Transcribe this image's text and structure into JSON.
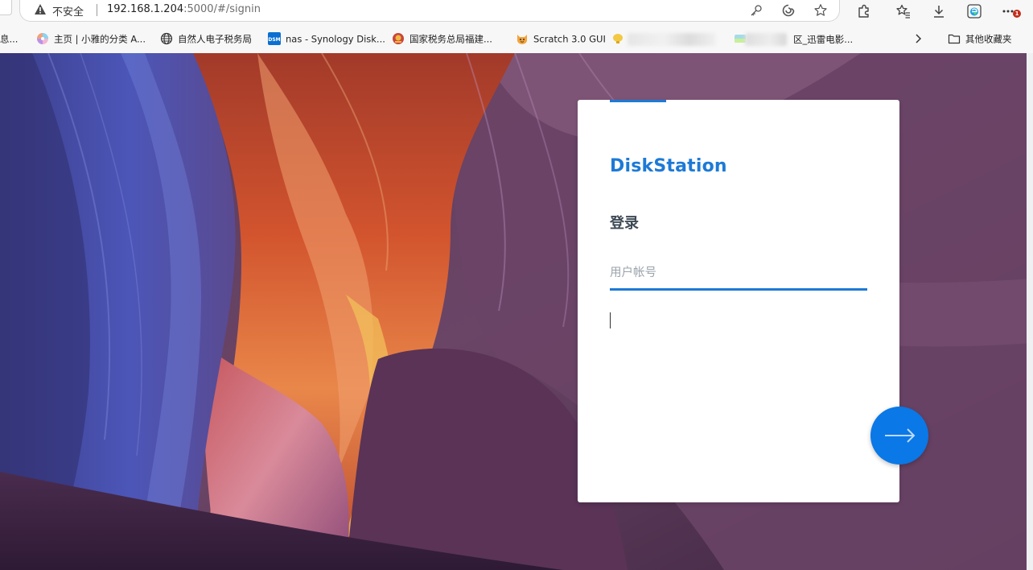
{
  "browser": {
    "security_label": "不安全",
    "url_host": "192.168.1.204",
    "url_rest": ":5000/#/signin",
    "notification_count": "1",
    "icons": [
      "warning-icon",
      "key-icon",
      "refresh-icon",
      "star-icon",
      "extensions-icon",
      "favorites-icon",
      "download-icon",
      "edge-icon",
      "more-icon"
    ]
  },
  "bookmarks": {
    "items": [
      {
        "label": "息..."
      },
      {
        "label": "主页 | 小雅的分类 A..."
      },
      {
        "label": "自然人电子税务局"
      },
      {
        "label": "nas - Synology Disk..."
      },
      {
        "label": "国家税务总局福建..."
      },
      {
        "label": "Scratch 3.0 GUI"
      },
      {
        "label": "区_迅雷电影..."
      }
    ],
    "other": "其他收藏夹",
    "dsm_icon_text": "DSM"
  },
  "login": {
    "brand": "DiskStation",
    "title": "登录",
    "username_placeholder": "用户帐号",
    "username_value": "",
    "accent_color": "#1d7ad6",
    "button_color": "#0a78e6"
  }
}
